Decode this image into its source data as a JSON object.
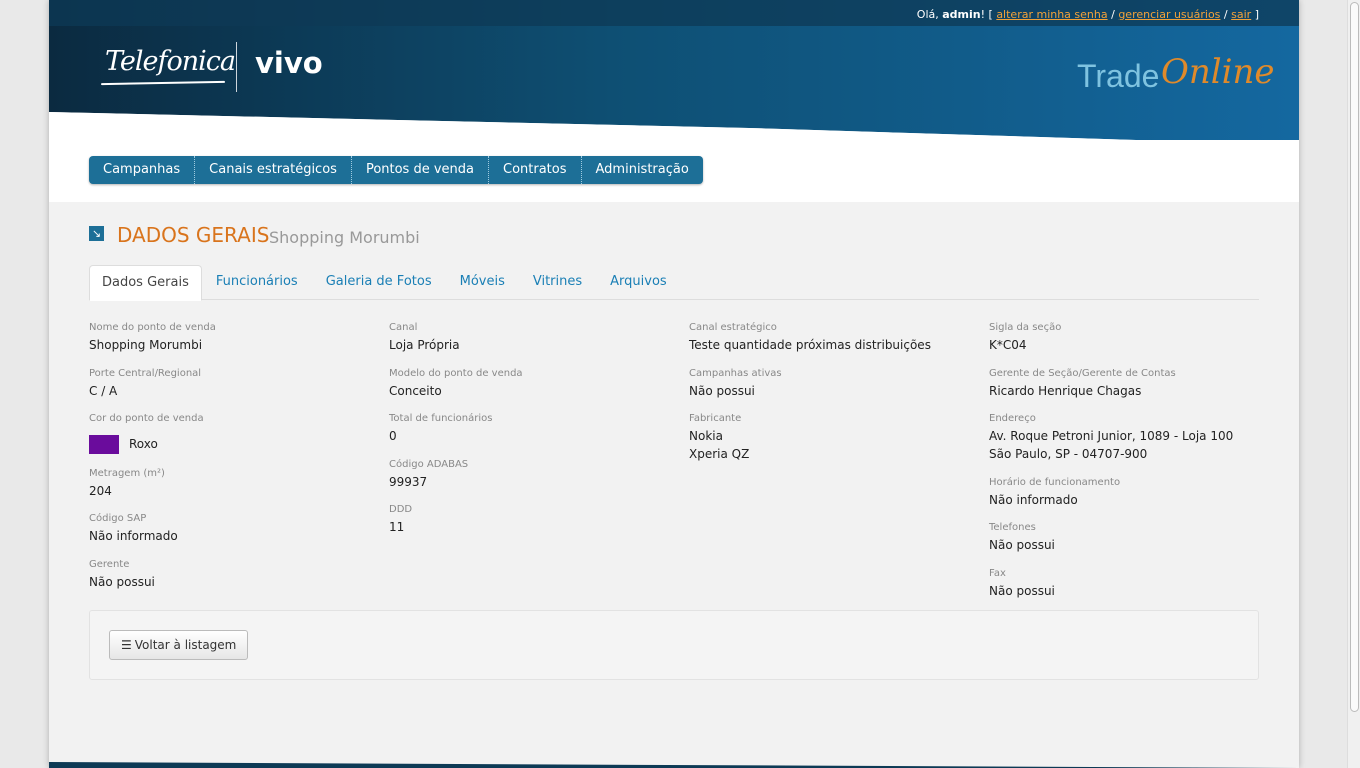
{
  "header": {
    "greeting": "Olá,",
    "user": "admin",
    "separator_open": "! [",
    "links": [
      "alterar minha senha",
      "gerenciar usuários",
      "sair"
    ],
    "slash": "/",
    "separator_close": "]",
    "logo_telefonica": "Telefonica",
    "logo_vivo": "vivo",
    "brand_trade": "Trade",
    "brand_online": "Online",
    "colors": {
      "primary": "#1d6f97",
      "dark": "#0b2d44",
      "accent": "#d9741c"
    }
  },
  "nav": [
    "Campanhas",
    "Canais estratégicos",
    "Pontos de venda",
    "Contratos",
    "Administração"
  ],
  "title": {
    "icon": "arrow-down-right-icon",
    "main": "DADOS GERAIS",
    "sub": "Shopping Morumbi"
  },
  "tabs": [
    "Dados Gerais",
    "Funcionários",
    "Galeria de Fotos",
    "Móveis",
    "Vitrines",
    "Arquivos"
  ],
  "col1": [
    {
      "label": "Nome do ponto de venda",
      "value": "Shopping Morumbi"
    },
    {
      "label": "Porte Central/Regional",
      "value": "C / A"
    },
    {
      "label": "Cor do ponto de venda",
      "value": "Roxo",
      "swatch": "#6a0c9c"
    },
    {
      "label": "Metragem (m²)",
      "value": "204"
    },
    {
      "label": "Código SAP",
      "value": "Não informado"
    },
    {
      "label": "Gerente",
      "value": "Não possui"
    }
  ],
  "col2": [
    {
      "label": "Canal",
      "value": "Loja Própria"
    },
    {
      "label": "Modelo do ponto de venda",
      "value": "Conceito"
    },
    {
      "label": "Total de funcionários",
      "value": "0"
    },
    {
      "label": "Código ADABAS",
      "value": "99937"
    },
    {
      "label": "DDD",
      "value": "11"
    }
  ],
  "col3": [
    {
      "label": "Canal estratégico",
      "value": "Teste quantidade próximas distribuições"
    },
    {
      "label": "Campanhas ativas",
      "value": "Não possui"
    },
    {
      "label": "Fabricante",
      "value": "Nokia",
      "value2": "Xperia QZ"
    }
  ],
  "col4": [
    {
      "label": "Sigla da seção",
      "value": "K*C04"
    },
    {
      "label": "Gerente de Seção/Gerente de Contas",
      "value": "Ricardo Henrique Chagas"
    },
    {
      "label": "Endereço",
      "value": "Av. Roque Petroni Junior, 1089 - Loja 100",
      "value2": "São Paulo, SP - 04707-900"
    },
    {
      "label": "Horário de funcionamento",
      "value": "Não informado"
    },
    {
      "label": "Telefones",
      "value": "Não possui"
    },
    {
      "label": "Fax",
      "value": "Não possui"
    }
  ],
  "footer": {
    "back_label": "Voltar à listagem",
    "back_icon": "list-icon"
  }
}
